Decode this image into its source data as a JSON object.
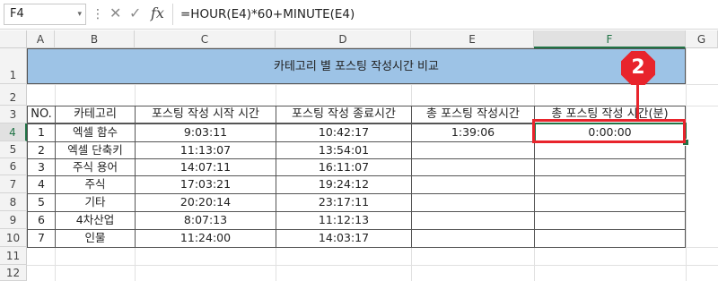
{
  "formula_bar": {
    "name_box": "F4",
    "name_box_arrow": "▾",
    "dots": "⋮",
    "cancel_icon": "✕",
    "enter_icon": "✓",
    "fx_label": "fx",
    "formula": "=HOUR(E4)*60+MINUTE(E4)"
  },
  "columns": [
    "A",
    "B",
    "C",
    "D",
    "E",
    "F",
    "G"
  ],
  "rows": [
    "1",
    "2",
    "3",
    "4",
    "5",
    "6",
    "7",
    "8",
    "9",
    "10",
    "11",
    "12"
  ],
  "sheet": {
    "title": "카테고리 별 포스팅 작성시간 비교",
    "headers": [
      "NO.",
      "카테고리",
      "포스팅 작성 시작 시간",
      "포스팅 작성 종료시간",
      "총 포스팅 작성시간",
      "총 포스팅 작성 시간(분)"
    ],
    "data_rows": [
      [
        "1",
        "엑셀 함수",
        "9:03:11",
        "10:42:17",
        "1:39:06",
        "0:00:00"
      ],
      [
        "2",
        "엑셀 단축키",
        "11:13:07",
        "13:54:01",
        "",
        ""
      ],
      [
        "3",
        "주식 용어",
        "14:07:11",
        "16:11:07",
        "",
        ""
      ],
      [
        "4",
        "주식",
        "17:03:21",
        "19:24:12",
        "",
        ""
      ],
      [
        "5",
        "기타",
        "20:20:14",
        "23:17:11",
        "",
        ""
      ],
      [
        "6",
        "4차산업",
        "8:07:13",
        "11:12:13",
        "",
        ""
      ],
      [
        "7",
        "인물",
        "11:24:00",
        "14:03:17",
        "",
        ""
      ]
    ]
  },
  "selected_cell": "F4",
  "callout": {
    "label": "2",
    "color": "#e8242c"
  },
  "colors": {
    "title_fill": "#9dc3e6",
    "selection": "#217346"
  }
}
